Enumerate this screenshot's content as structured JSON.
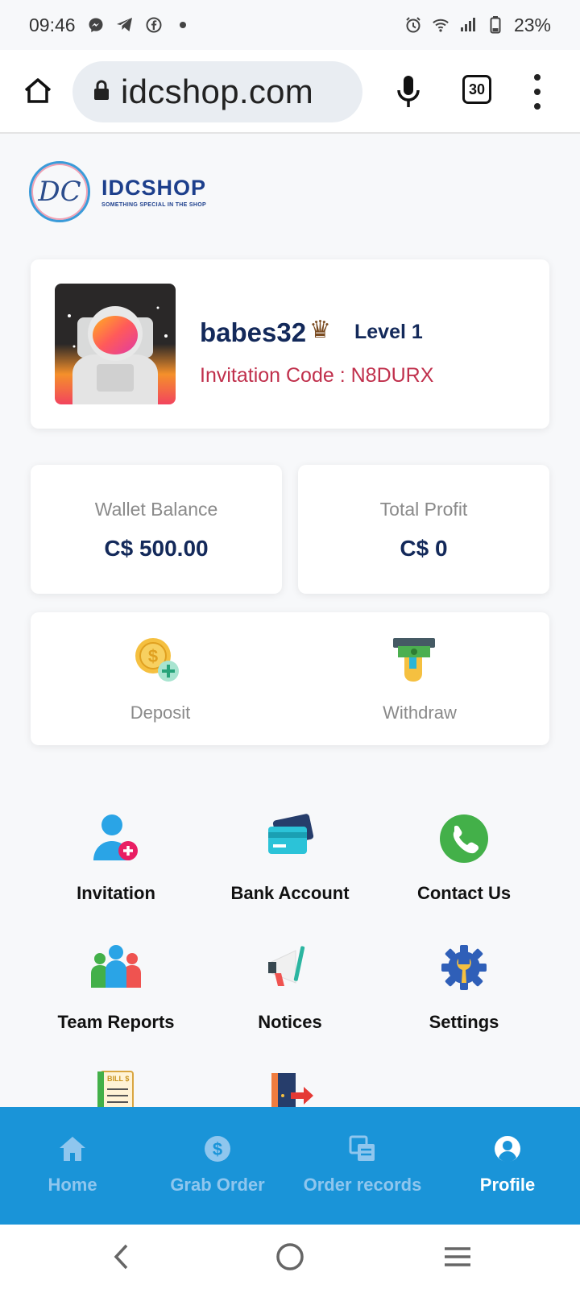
{
  "status_bar": {
    "time": "09:46",
    "battery": "23%",
    "icons": [
      "messenger-icon",
      "telegram-icon",
      "facebook-icon",
      "dot-icon",
      "alarm-icon",
      "wifi-icon",
      "signal-icon",
      "battery-icon"
    ]
  },
  "browser": {
    "url": "idcshop.com",
    "tab_count": "30",
    "icons": [
      "home-icon",
      "lock-icon",
      "mic-icon",
      "tabs-icon",
      "more-icon"
    ]
  },
  "logo": {
    "monogram": "DC",
    "name": "IDCSHOP",
    "tagline": "SOMETHING SPECIAL IN THE SHOP"
  },
  "profile": {
    "username": "babes32",
    "crown": "♛",
    "level": "Level 1",
    "invitation_code": "Invitation Code : N8DURX"
  },
  "balances": {
    "wallet_label": "Wallet Balance",
    "wallet_value": "C$ 500.00",
    "profit_label": "Total Profit",
    "profit_value": "C$ 0"
  },
  "actions": {
    "deposit": "Deposit",
    "withdraw": "Withdraw"
  },
  "menu": [
    {
      "label": "Invitation",
      "icon": "add-user-icon"
    },
    {
      "label": "Bank Account",
      "icon": "bank-card-icon"
    },
    {
      "label": "Contact Us",
      "icon": "phone-icon"
    },
    {
      "label": "Team Reports",
      "icon": "team-icon"
    },
    {
      "label": "Notices",
      "icon": "megaphone-icon"
    },
    {
      "label": "Settings",
      "icon": "settings-icon"
    },
    {
      "label": "",
      "icon": "bill-icon",
      "bill_text": "BILL $"
    },
    {
      "label": "",
      "icon": "logout-icon"
    }
  ],
  "bottom_nav": {
    "home": "Home",
    "grab_order": "Grab Order",
    "order_records": "Order records",
    "profile": "Profile",
    "active": "Profile",
    "color": "#1a94d8"
  },
  "colors": {
    "primary_text": "#13295a",
    "invite_red": "#c0304c",
    "nav_blue": "#1a94d8"
  }
}
